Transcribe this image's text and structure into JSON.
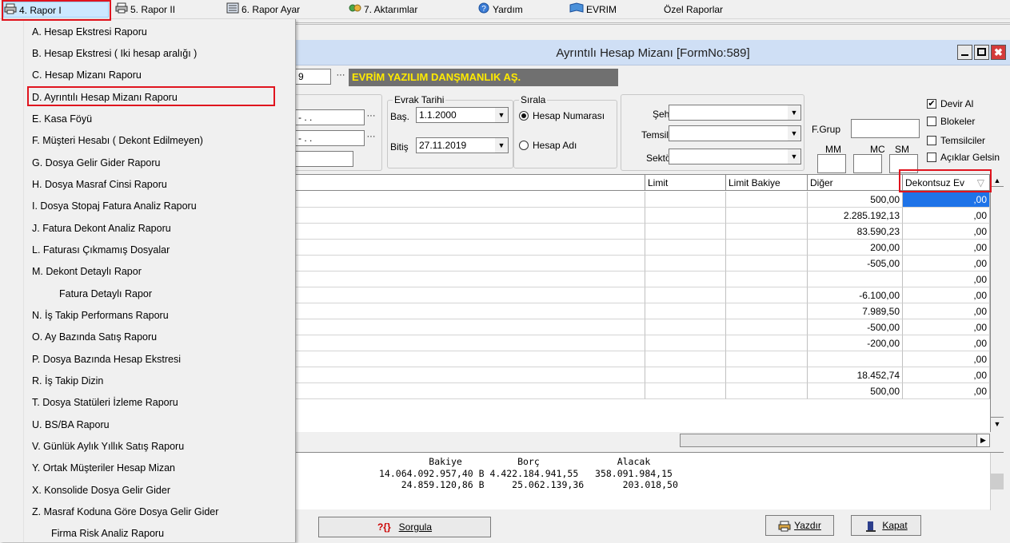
{
  "menubar": {
    "items": [
      {
        "label": "4.  Rapor I"
      },
      {
        "label": "5.  Rapor II"
      },
      {
        "label": "6.  Rapor Ayar"
      },
      {
        "label": "7.  Aktarımlar"
      },
      {
        "label": "Yardım"
      },
      {
        "label": "EVRIM"
      },
      {
        "label": "Özel Raporlar"
      }
    ]
  },
  "dropdown": {
    "items": [
      {
        "label": "A.  Hesap Ekstresi Raporu"
      },
      {
        "label": "B.  Hesap Ekstresi ( Iki hesap aralığı )"
      },
      {
        "label": "C.  Hesap Mizanı Raporu"
      },
      {
        "label": "D.  Ayrıntılı Hesap Mizanı Raporu"
      },
      {
        "label": "E.  Kasa Föyü"
      },
      {
        "label": "F.  Müşteri Hesabı ( Dekont Edilmeyen)"
      },
      {
        "label": "G.  Dosya Gelir Gider Raporu"
      },
      {
        "label": "H.  Dosya Masraf Cinsi Raporu"
      },
      {
        "label": "I.  Dosya Stopaj Fatura Analiz Raporu"
      },
      {
        "label": "J.  Fatura Dekont Analiz Raporu"
      },
      {
        "label": "L.  Faturası Çıkmamış Dosyalar"
      },
      {
        "label": "M.   Dekont Detaylı Rapor"
      },
      {
        "label": "Fatura Detaylı Rapor"
      },
      {
        "label": "N.  İş Takip Performans Raporu"
      },
      {
        "label": "O.  Ay Bazında Satış Raporu"
      },
      {
        "label": "P.  Dosya Bazında Hesap Ekstresi"
      },
      {
        "label": "R.  İş Takip Dizin"
      },
      {
        "label": "T.  Dosya Statüleri İzleme Raporu"
      },
      {
        "label": "U.  BS/BA Raporu"
      },
      {
        "label": "V. Günlük Aylık Yıllık Satış Raporu"
      },
      {
        "label": "Y. Ortak Müşteriler Hesap Mizan"
      },
      {
        "label": "X. Konsolide Dosya Gelir Gider"
      },
      {
        "label": "Z. Masraf Koduna Göre Dosya Gelir Gider"
      },
      {
        "label": "Firma Risk Analiz Raporu"
      }
    ]
  },
  "window": {
    "title": "Ayrıntılı Hesap Mizanı [FormNo:589]",
    "company_code": "9",
    "company_name": "EVRİM YAZILIM DANŞMANLIK AŞ.",
    "left_field1": "- . .",
    "left_field2": "- . .",
    "evrak_tarihi_label": "Evrak Tarihi",
    "bas_label": "Baş.",
    "bas_value": "1.1.2000",
    "bitis_label": "Bitiş",
    "bitis_value": "27.11.2019",
    "sirala_label": "Sırala",
    "radio_hesap_no": "Hesap Numarası",
    "radio_hesap_adi": "Hesap Adı",
    "sehir_label": "Şehir",
    "temsilci_label": "Temsilci",
    "sektor_label": "Sektör",
    "fgrup_label": "F.Grup",
    "mm_label": "MM",
    "mc_label": "MC",
    "sm_label": "SM",
    "chk_devir": "Devir Al",
    "chk_blokeler": "Blokeler",
    "chk_temsilciler": "Temsilciler",
    "chk_aciklar": "Açıklar Gelsin",
    "chk_devir_checked": "✔"
  },
  "grid": {
    "headers": {
      "limit": "Limit",
      "limit_bakiye": "Limit Bakiye",
      "diger": "Diğer",
      "dekontsuz": "Dekontsuz Ev"
    },
    "sort_icon": "▽",
    "rows": [
      {
        "diger": "500,00",
        "dekontsuz": ",00"
      },
      {
        "diger": "2.285.192,13",
        "dekontsuz": ",00"
      },
      {
        "diger": "83.590,23",
        "dekontsuz": ",00"
      },
      {
        "diger": "200,00",
        "dekontsuz": ",00"
      },
      {
        "diger": "-505,00",
        "dekontsuz": ",00"
      },
      {
        "diger": "",
        "dekontsuz": ",00"
      },
      {
        "diger": "-6.100,00",
        "dekontsuz": ",00"
      },
      {
        "diger": "7.989,50",
        "dekontsuz": ",00"
      },
      {
        "diger": "-500,00",
        "dekontsuz": ",00"
      },
      {
        "diger": "-200,00",
        "dekontsuz": ",00"
      },
      {
        "diger": "",
        "dekontsuz": ",00"
      },
      {
        "diger": "18.452,74",
        "dekontsuz": ",00"
      },
      {
        "diger": "500,00",
        "dekontsuz": ",00"
      }
    ]
  },
  "totals": {
    "header": "         Bakiye          Borç              Alacak",
    "line1": "14.064.092.957,40 B 4.422.184.941,55   358.091.984,15",
    "line2": "    24.859.120,86 B     25.062.139,36       203.018,50"
  },
  "buttons": {
    "sorgula": "Sorgula",
    "sorgula_icon": "?{}",
    "yazdir": "Yazdır",
    "kapat": "Kapat"
  }
}
